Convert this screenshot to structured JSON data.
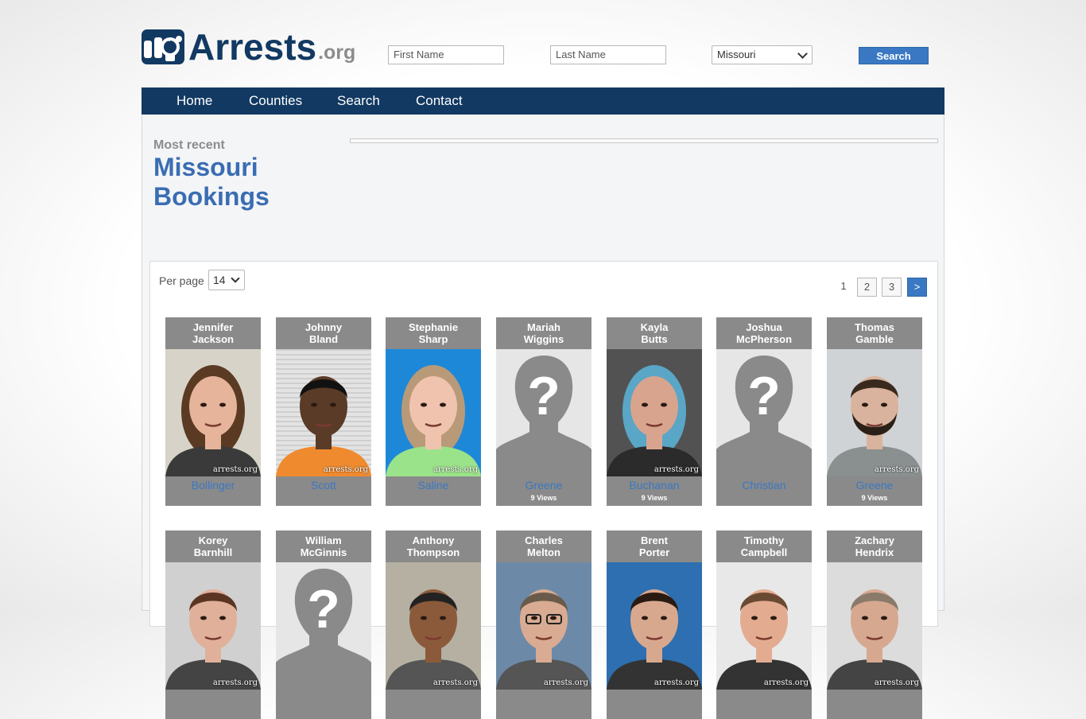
{
  "header": {
    "logo_text": "Arrests",
    "logo_suffix": ".org",
    "first_name_placeholder": "First Name",
    "last_name_placeholder": "Last Name",
    "state_selected": "Missouri",
    "search_label": "Search"
  },
  "nav": [
    "Home",
    "Counties",
    "Search",
    "Contact"
  ],
  "page": {
    "kicker": "Most recent",
    "title_line1": "Missouri",
    "title_line2": "Bookings"
  },
  "listing": {
    "per_page_label": "Per page",
    "per_page_value": "14",
    "pagination": {
      "current": "1",
      "pages": [
        "2",
        "3"
      ],
      "next": ">"
    }
  },
  "watermark": "arrests.org",
  "colors": {
    "navy": "#123962",
    "accent": "#3a78c3",
    "card_bg": "#8a8a8a"
  },
  "cards": [
    {
      "first": "Jennifer",
      "last": "Jackson",
      "county": "Bollinger",
      "views": "",
      "photo": "woman-light"
    },
    {
      "first": "Johnny",
      "last": "Bland",
      "county": "Scott",
      "views": "",
      "photo": "man-dark"
    },
    {
      "first": "Stephanie",
      "last": "Sharp",
      "county": "Saline",
      "views": "",
      "photo": "woman-blue"
    },
    {
      "first": "Mariah",
      "last": "Wiggins",
      "county": "Greene",
      "views": "9 Views",
      "photo": "placeholder"
    },
    {
      "first": "Kayla",
      "last": "Butts",
      "county": "Buchanan",
      "views": "9 Views",
      "photo": "woman-dark"
    },
    {
      "first": "Joshua",
      "last": "McPherson",
      "county": "Christian",
      "views": "",
      "photo": "placeholder"
    },
    {
      "first": "Thomas",
      "last": "Gamble",
      "county": "Greene",
      "views": "9 Views",
      "photo": "man-beard"
    },
    {
      "first": "Korey",
      "last": "Barnhill",
      "county": "",
      "views": "",
      "photo": "woman-grey"
    },
    {
      "first": "William",
      "last": "McGinnis",
      "county": "",
      "views": "",
      "photo": "placeholder"
    },
    {
      "first": "Anthony",
      "last": "Thompson",
      "county": "",
      "views": "",
      "photo": "man-tan"
    },
    {
      "first": "Charles",
      "last": "Melton",
      "county": "",
      "views": "",
      "photo": "man-glasses"
    },
    {
      "first": "Brent",
      "last": "Porter",
      "county": "",
      "views": "",
      "photo": "man-blue"
    },
    {
      "first": "Timothy",
      "last": "Campbell",
      "county": "",
      "views": "",
      "photo": "man-white"
    },
    {
      "first": "Zachary",
      "last": "Hendrix",
      "county": "",
      "views": "",
      "photo": "man-old"
    }
  ]
}
